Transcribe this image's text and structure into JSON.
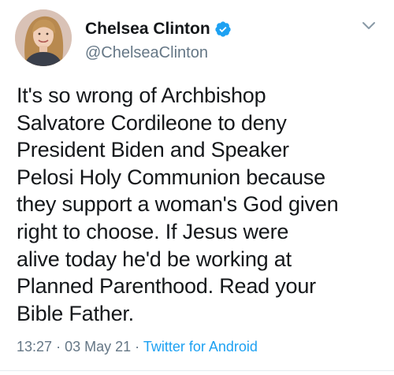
{
  "tweet": {
    "author": {
      "display_name": "Chelsea Clinton",
      "handle": "@ChelseaClinton",
      "verified": true,
      "avatar_icon": "profile-photo"
    },
    "text": "It's so wrong of Archbishop\nSalvatore Cordileone to deny\nPresident Biden and Speaker\nPelosi Holy Communion because\nthey support a woman's God given\nright to choose. If Jesus were\nalive today he'd be working at\nPlanned Parenthood. Read your\nBible Father.",
    "time": "13:27",
    "separator": "·",
    "date": "03 May 21",
    "source": "Twitter for Android"
  },
  "icons": {
    "verified": "verified-badge-icon",
    "menu": "chevron-down-icon"
  },
  "colors": {
    "name": "#14171a",
    "secondary": "#657786",
    "link": "#1da1f2",
    "verified": "#1da1f2"
  }
}
